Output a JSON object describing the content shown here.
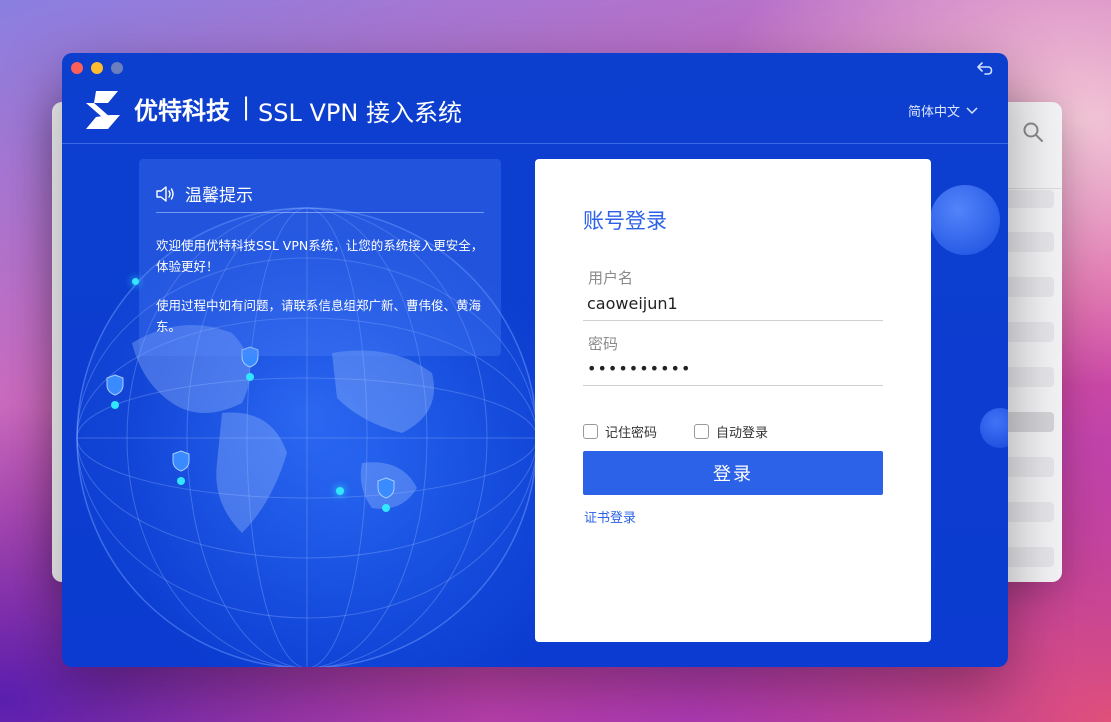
{
  "app": {
    "brand": "优特科技",
    "separator": "|",
    "system_name": "SSL VPN 接入系统",
    "language": "简体中文"
  },
  "tip": {
    "title": "温馨提示",
    "paragraph1": "欢迎使用优特科技SSL VPN系统，让您的系统接入更安全，体验更好！",
    "paragraph2": "使用过程中如有问题，请联系信息组郑广新、曹伟俊、黄海东。"
  },
  "login": {
    "title": "账号登录",
    "username_label": "用户名",
    "username_value": "caoweijun1",
    "password_label": "密码",
    "password_value": "••••••••••",
    "remember_password": "记住密码",
    "auto_login": "自动登录",
    "submit": "登录",
    "cert_login": "证书登录"
  },
  "icons": {
    "logo": "brand-s-logo",
    "speaker": "speaker-icon",
    "chevron": "chevron-down-icon",
    "back": "back-arrow-icon",
    "search": "search-icon"
  },
  "colors": {
    "primary": "#2c62e8",
    "window_bg": "#0b3bd0",
    "close": "#fe5f57",
    "minimize": "#febc2e"
  }
}
